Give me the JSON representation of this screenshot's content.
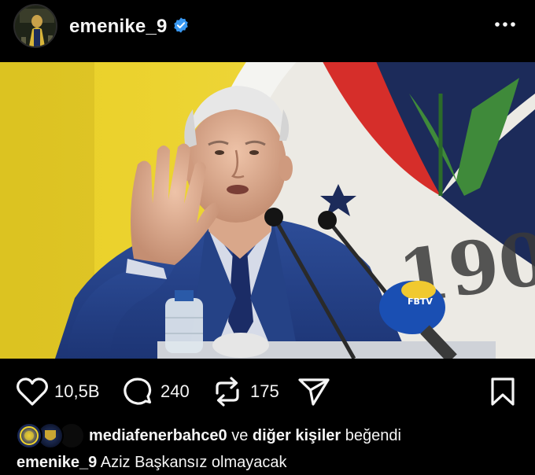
{
  "header": {
    "username": "emenike_9",
    "verified": true,
    "more_icon": "more-horizontal-icon"
  },
  "post": {
    "image_description_icon": "photo"
  },
  "actions": {
    "likes_count": "10,5B",
    "comments_count": "240",
    "reposts_count": "175",
    "icons": [
      "heart-icon",
      "comment-icon",
      "repost-icon",
      "share-icon",
      "bookmark-icon"
    ]
  },
  "likes_line": {
    "first_liker": "mediafenerbahce0",
    "connector": "ve",
    "others": "diğer kişiler",
    "suffix": "beğendi"
  },
  "caption": {
    "author": "emenike_9",
    "text": "Aziz Başkansız olmayacak"
  },
  "colors": {
    "background": "#000000",
    "text": "#f5f5f5",
    "verified_blue": "#3897f0",
    "fenerbahce_yellow": "#f0d42a",
    "fenerbahce_navy": "#1c2b5a"
  }
}
